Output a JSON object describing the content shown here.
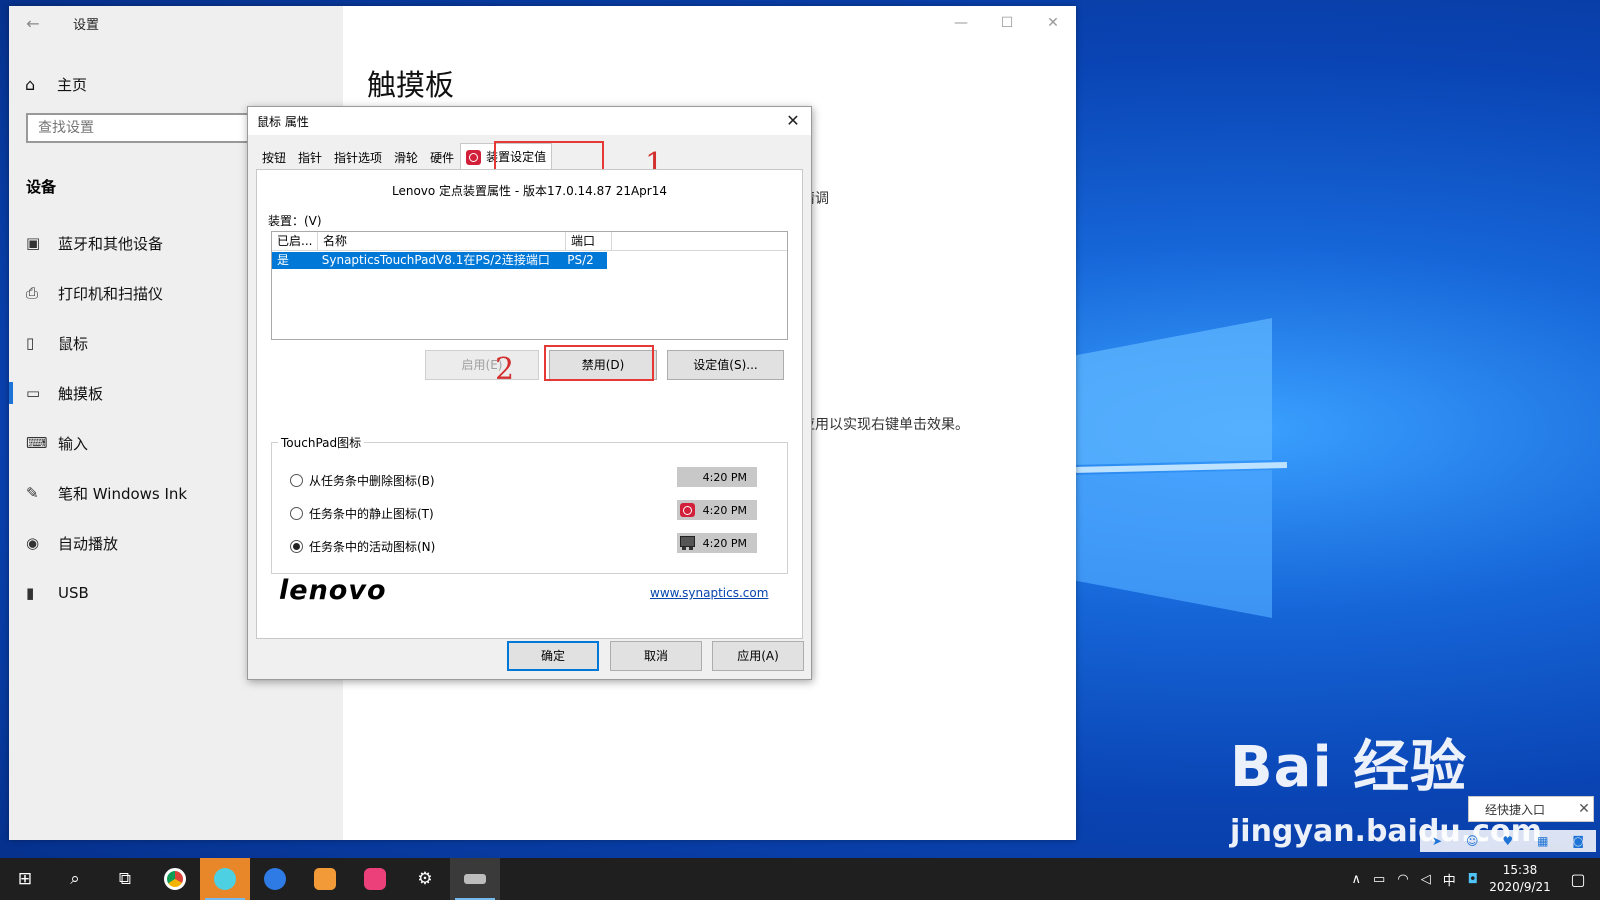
{
  "settings": {
    "back_icon": "←",
    "app_title": "设置",
    "home_label": "主页",
    "search_placeholder": "查找设置",
    "section": "设备",
    "nav": [
      {
        "icon": "bluetooth-icon",
        "label": "蓝牙和其他设备"
      },
      {
        "icon": "printer-icon",
        "label": "打印机和扫描仪"
      },
      {
        "icon": "mouse-icon",
        "label": "鼠标"
      },
      {
        "icon": "touchpad-icon",
        "label": "触摸板"
      },
      {
        "icon": "keyboard-icon",
        "label": "输入"
      },
      {
        "icon": "pen-icon",
        "label": "笔和 Windows Ink"
      },
      {
        "icon": "autoplay-icon",
        "label": "自动播放"
      },
      {
        "icon": "usb-icon",
        "label": "USB"
      }
    ],
    "active_nav_index": 3,
    "page_title": "触摸板",
    "content_fragment_1": "情调",
    "content_fragment_2": "应用以实现右键单击效果。"
  },
  "dialog": {
    "title": "鼠标 属性",
    "tabs": [
      "按钮",
      "指针",
      "指针选项",
      "滑轮",
      "硬件",
      "装置设定值"
    ],
    "selected_tab_index": 5,
    "version_text": "Lenovo 定点装置属性 - 版本17.0.14.87 21Apr14",
    "devices_label": "装置：(V)",
    "table": {
      "headers": [
        "已启...",
        "名称",
        "端口"
      ],
      "rows": [
        [
          "是",
          "SynapticsTouchPadV8.1在PS/2连接端口",
          "PS/2"
        ]
      ]
    },
    "buttons": {
      "enable": "启用(E)",
      "disable": "禁用(D)",
      "settings": "设定值(S)..."
    },
    "group_title": "TouchPad图标",
    "radio_options": [
      {
        "label": "从任务条中删除图标(B)",
        "time": "4:20 PM",
        "icon": ""
      },
      {
        "label": "任务条中的静止图标(T)",
        "time": "4:20 PM",
        "icon": "synaptics-icon"
      },
      {
        "label": "任务条中的活动图标(N)",
        "time": "4:20 PM",
        "icon": "touchpad-activity-icon"
      }
    ],
    "selected_radio_index": 2,
    "brand": "lenovo",
    "link": "www.synaptics.com",
    "footer": {
      "ok": "确定",
      "cancel": "取消",
      "apply": "应用(A)"
    }
  },
  "annotations": {
    "step1": "1",
    "step2": "2",
    "color": "#e53935"
  },
  "watermark": {
    "main": "Bai 经验",
    "sub": "jingyan.baidu.com"
  },
  "notify_popup": {
    "text": "经快捷入口"
  },
  "taskbar": {
    "apps": [
      "start-icon",
      "search-icon",
      "task-view-icon",
      "chrome-icon",
      "pencil-app-icon",
      "feishu-icon",
      "photo-app-icon",
      "music-app-icon",
      "gear-icon",
      "touchpad-app-icon"
    ],
    "ime": "中",
    "time": "15:38",
    "date": "2020/9/21"
  },
  "colors": {
    "accent": "#0078d7",
    "highlight": "#e53935",
    "taskbar": "#1f1f1f"
  }
}
